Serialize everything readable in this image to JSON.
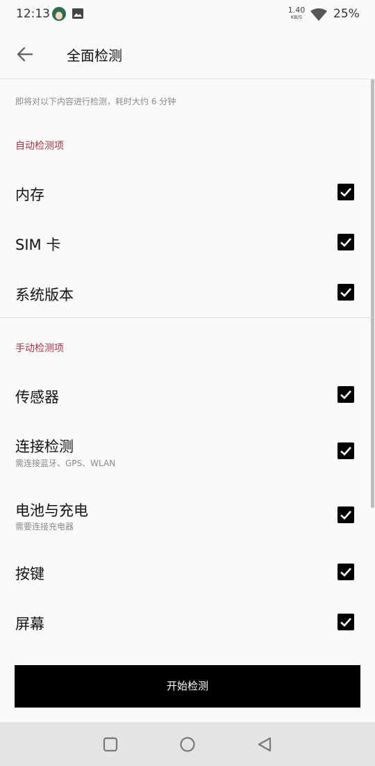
{
  "status_bar": {
    "time": "12:13",
    "net_speed_value": "1.40",
    "net_speed_unit": "KB/S",
    "battery": "25%"
  },
  "app_bar": {
    "title": "全面检测"
  },
  "intro": "即将对以下内容进行检测，耗时大约 6 分钟",
  "sections": {
    "auto": {
      "header": "自动检测项",
      "items": [
        {
          "label": "内存",
          "checked": true
        },
        {
          "label": "SIM 卡",
          "checked": true
        },
        {
          "label": "系统版本",
          "checked": true
        }
      ]
    },
    "manual": {
      "header": "手动检测项",
      "items": [
        {
          "label": "传感器",
          "checked": true
        },
        {
          "label": "连接检测",
          "subtitle": "需连接蓝牙、GPS、WLAN",
          "checked": true
        },
        {
          "label": "电池与充电",
          "subtitle": "需要连接充电器",
          "checked": true
        },
        {
          "label": "按键",
          "checked": true
        },
        {
          "label": "屏幕",
          "checked": true
        }
      ]
    }
  },
  "start_button": "开始检测",
  "colors": {
    "accent": "#a8324a",
    "button_bg": "#000000",
    "background": "#fafafa"
  }
}
